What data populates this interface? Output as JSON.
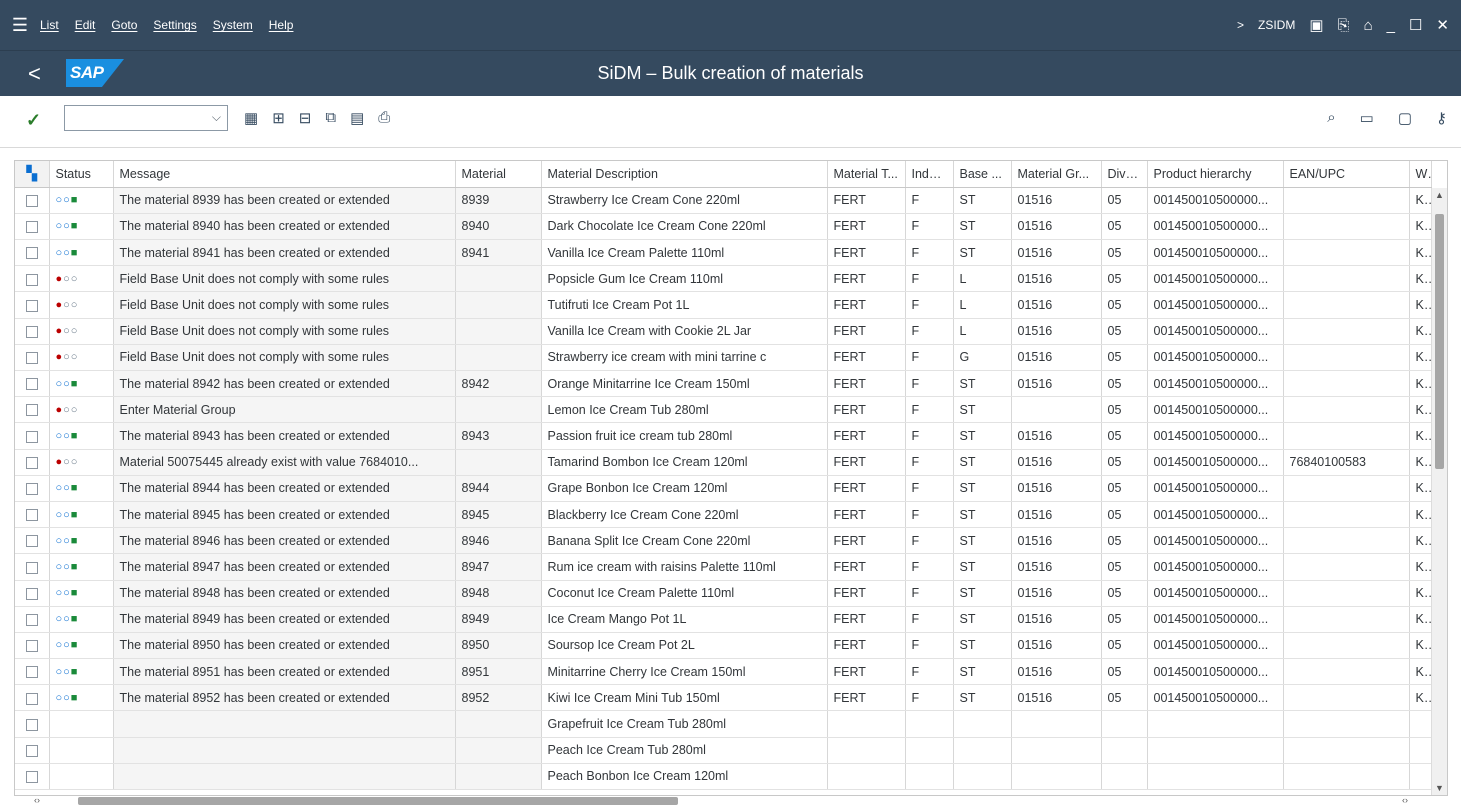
{
  "menu": {
    "items": [
      "List",
      "Edit",
      "Goto",
      "Settings",
      "System",
      "Help"
    ],
    "transaction": "ZSIDM",
    "arrow": ">"
  },
  "header": {
    "back": "<",
    "logo": "SAP",
    "title": "SiDM – Bulk creation of materials"
  },
  "toolbar": {
    "select_value": ""
  },
  "grid": {
    "columns": [
      "Status",
      "Message",
      "Material",
      "Material Description",
      "Material T...",
      "Indus...",
      "Base ...",
      "Material Gr...",
      "Divisi...",
      "Product hierarchy",
      "EAN/UPC",
      "W"
    ],
    "rows": [
      {
        "status": "ok",
        "message": "The material 8939 has been created or extended",
        "material": "8939",
        "desc": "Strawberry Ice Cream Cone 220ml",
        "mtype": "FERT",
        "indus": "F",
        "base": "ST",
        "mgroup": "01516",
        "div": "05",
        "hier": "001450010500000...",
        "ean": "",
        "w": "K("
      },
      {
        "status": "ok",
        "message": "The material 8940 has been created or extended",
        "material": "8940",
        "desc": "Dark Chocolate Ice Cream Cone 220ml",
        "mtype": "FERT",
        "indus": "F",
        "base": "ST",
        "mgroup": "01516",
        "div": "05",
        "hier": "001450010500000...",
        "ean": "",
        "w": "K("
      },
      {
        "status": "ok",
        "message": "The material 8941 has been created or extended",
        "material": "8941",
        "desc": "Vanilla Ice Cream Palette 110ml",
        "mtype": "FERT",
        "indus": "F",
        "base": "ST",
        "mgroup": "01516",
        "div": "05",
        "hier": "001450010500000...",
        "ean": "",
        "w": "K("
      },
      {
        "status": "err",
        "message": "Field Base Unit does not comply with some rules",
        "material": "",
        "desc": "Popsicle Gum Ice Cream 110ml",
        "mtype": "FERT",
        "indus": "F",
        "base": "L",
        "mgroup": "01516",
        "div": "05",
        "hier": "001450010500000...",
        "ean": "",
        "w": "K("
      },
      {
        "status": "err",
        "message": "Field Base Unit does not comply with some rules",
        "material": "",
        "desc": "Tutifruti Ice Cream Pot 1L",
        "mtype": "FERT",
        "indus": "F",
        "base": "L",
        "mgroup": "01516",
        "div": "05",
        "hier": "001450010500000...",
        "ean": "",
        "w": "K("
      },
      {
        "status": "err",
        "message": "Field Base Unit does not comply with some rules",
        "material": "",
        "desc": "Vanilla Ice Cream with Cookie 2L Jar",
        "mtype": "FERT",
        "indus": "F",
        "base": "L",
        "mgroup": "01516",
        "div": "05",
        "hier": "001450010500000...",
        "ean": "",
        "w": "K("
      },
      {
        "status": "err",
        "message": "Field Base Unit does not comply with some rules",
        "material": "",
        "desc": "Strawberry ice cream with mini tarrine c",
        "mtype": "FERT",
        "indus": "F",
        "base": "G",
        "mgroup": "01516",
        "div": "05",
        "hier": "001450010500000...",
        "ean": "",
        "w": "K("
      },
      {
        "status": "ok",
        "message": "The material 8942 has been created or extended",
        "material": "8942",
        "desc": "Orange Minitarrine Ice Cream 150ml",
        "mtype": "FERT",
        "indus": "F",
        "base": "ST",
        "mgroup": "01516",
        "div": "05",
        "hier": "001450010500000...",
        "ean": "",
        "w": "K("
      },
      {
        "status": "err",
        "message": "Enter Material Group",
        "material": "",
        "desc": "Lemon Ice Cream Tub 280ml",
        "mtype": "FERT",
        "indus": "F",
        "base": "ST",
        "mgroup": "",
        "div": "05",
        "hier": "001450010500000...",
        "ean": "",
        "w": "K("
      },
      {
        "status": "ok",
        "message": "The material 8943 has been created or extended",
        "material": "8943",
        "desc": "Passion fruit ice cream tub 280ml",
        "mtype": "FERT",
        "indus": "F",
        "base": "ST",
        "mgroup": "01516",
        "div": "05",
        "hier": "001450010500000...",
        "ean": "",
        "w": "K("
      },
      {
        "status": "err",
        "message": "Material 50075445 already exist with value 7684010...",
        "material": "",
        "desc": "Tamarind Bombon Ice Cream 120ml",
        "mtype": "FERT",
        "indus": "F",
        "base": "ST",
        "mgroup": "01516",
        "div": "05",
        "hier": "001450010500000...",
        "ean": "76840100583",
        "w": "K("
      },
      {
        "status": "ok",
        "message": "The material 8944 has been created or extended",
        "material": "8944",
        "desc": "Grape Bonbon Ice Cream 120ml",
        "mtype": "FERT",
        "indus": "F",
        "base": "ST",
        "mgroup": "01516",
        "div": "05",
        "hier": "001450010500000...",
        "ean": "",
        "w": "K("
      },
      {
        "status": "ok",
        "message": "The material 8945 has been created or extended",
        "material": "8945",
        "desc": "Blackberry Ice Cream Cone 220ml",
        "mtype": "FERT",
        "indus": "F",
        "base": "ST",
        "mgroup": "01516",
        "div": "05",
        "hier": "001450010500000...",
        "ean": "",
        "w": "K("
      },
      {
        "status": "ok",
        "message": "The material 8946 has been created or extended",
        "material": "8946",
        "desc": "Banana Split Ice Cream Cone 220ml",
        "mtype": "FERT",
        "indus": "F",
        "base": "ST",
        "mgroup": "01516",
        "div": "05",
        "hier": "001450010500000...",
        "ean": "",
        "w": "K("
      },
      {
        "status": "ok",
        "message": "The material 8947 has been created or extended",
        "material": "8947",
        "desc": "Rum ice cream with raisins Palette 110ml",
        "mtype": "FERT",
        "indus": "F",
        "base": "ST",
        "mgroup": "01516",
        "div": "05",
        "hier": "001450010500000...",
        "ean": "",
        "w": "K("
      },
      {
        "status": "ok",
        "message": "The material 8948 has been created or extended",
        "material": "8948",
        "desc": "Coconut Ice Cream Palette 110ml",
        "mtype": "FERT",
        "indus": "F",
        "base": "ST",
        "mgroup": "01516",
        "div": "05",
        "hier": "001450010500000...",
        "ean": "",
        "w": "K("
      },
      {
        "status": "ok",
        "message": "The material 8949 has been created or extended",
        "material": "8949",
        "desc": "Ice Cream Mango Pot 1L",
        "mtype": "FERT",
        "indus": "F",
        "base": "ST",
        "mgroup": "01516",
        "div": "05",
        "hier": "001450010500000...",
        "ean": "",
        "w": "K("
      },
      {
        "status": "ok",
        "message": "The material 8950 has been created or extended",
        "material": "8950",
        "desc": "Soursop Ice Cream Pot 2L",
        "mtype": "FERT",
        "indus": "F",
        "base": "ST",
        "mgroup": "01516",
        "div": "05",
        "hier": "001450010500000...",
        "ean": "",
        "w": "K("
      },
      {
        "status": "ok",
        "message": "The material 8951 has been created or extended",
        "material": "8951",
        "desc": "Minitarrine Cherry Ice Cream 150ml",
        "mtype": "FERT",
        "indus": "F",
        "base": "ST",
        "mgroup": "01516",
        "div": "05",
        "hier": "001450010500000...",
        "ean": "",
        "w": "K("
      },
      {
        "status": "ok",
        "message": "The material 8952 has been created or extended",
        "material": "8952",
        "desc": "Kiwi Ice Cream Mini Tub 150ml",
        "mtype": "FERT",
        "indus": "F",
        "base": "ST",
        "mgroup": "01516",
        "div": "05",
        "hier": "001450010500000...",
        "ean": "",
        "w": "K("
      },
      {
        "status": "",
        "message": "",
        "material": "",
        "desc": "Grapefruit Ice Cream Tub 280ml",
        "mtype": "",
        "indus": "",
        "base": "",
        "mgroup": "",
        "div": "",
        "hier": "",
        "ean": "",
        "w": ""
      },
      {
        "status": "",
        "message": "",
        "material": "",
        "desc": "Peach Ice Cream Tub 280ml",
        "mtype": "",
        "indus": "",
        "base": "",
        "mgroup": "",
        "div": "",
        "hier": "",
        "ean": "",
        "w": ""
      },
      {
        "status": "",
        "message": "",
        "material": "",
        "desc": "Peach Bonbon Ice Cream 120ml",
        "mtype": "",
        "indus": "",
        "base": "",
        "mgroup": "",
        "div": "",
        "hier": "",
        "ean": "",
        "w": ""
      }
    ]
  },
  "colors": {
    "shell": "#354a5f",
    "accent": "#0a6ed1",
    "ok": "#1a8a3a",
    "error": "#bb0000"
  },
  "icons": {
    "menu": "hamburger-icon",
    "confirm": "checkmark-icon",
    "toolbar": [
      "table-icon",
      "select-all-icon",
      "deselect-icon",
      "copy-icon",
      "fill-icon",
      "export-icon"
    ],
    "right": [
      "search-icon",
      "window-icon",
      "window-restore-icon",
      "key-icon"
    ]
  }
}
